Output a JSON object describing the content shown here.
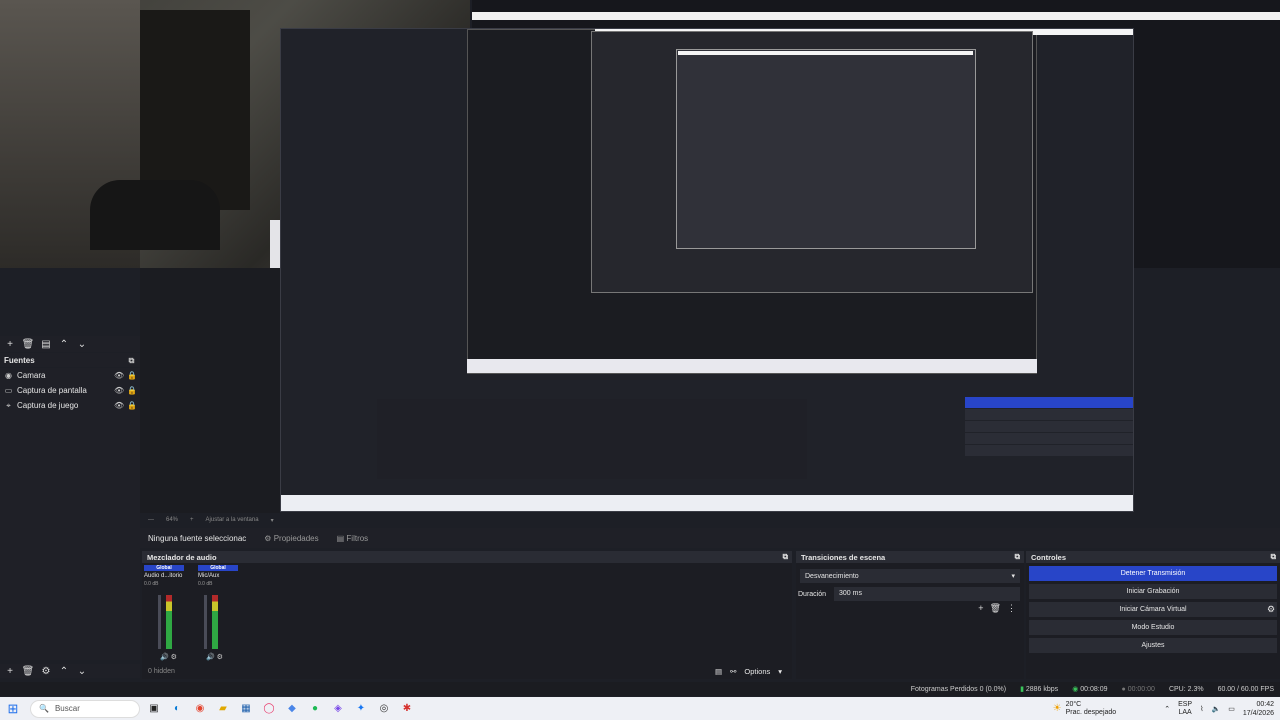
{
  "sources": {
    "title": "Fuentes",
    "items": [
      {
        "label": "Camara"
      },
      {
        "label": "Captura de pantalla"
      },
      {
        "label": "Captura de juego"
      }
    ]
  },
  "noselect": {
    "text": "Ninguna fuente seleccionac",
    "properties": "Propiedades",
    "filters": "Filtros"
  },
  "zoom": {
    "percent": "64%",
    "fit": "Ajustar a la ventana"
  },
  "mixer": {
    "title": "Mezclador de audio",
    "channels": [
      {
        "group": "Global",
        "device": "Audio d...itorio",
        "db": "0.0 dB"
      },
      {
        "group": "Global",
        "device": "Mic/Aux",
        "db": "0.0 dB"
      }
    ],
    "hidden": "0 hidden",
    "options": "Options"
  },
  "transitions": {
    "title": "Transiciones de escena",
    "selected": "Desvanecimiento",
    "duration_label": "Duración",
    "duration_value": "300 ms"
  },
  "controls": {
    "title": "Controles",
    "stop_stream": "Detener Transmisión",
    "start_record": "Iniciar Grabación",
    "virtual_cam": "Iniciar Cámara Virtual",
    "studio_mode": "Modo Estudio",
    "settings": "Ajustes"
  },
  "status": {
    "dropped": "Fotogramas Perdidos 0 (0.0%)",
    "kbps": "2886 kbps",
    "stream_time": "00:08:09",
    "rec_time": "00:00:00",
    "cpu": "CPU: 2.3%",
    "fps": "60.00 / 60.00 FPS"
  },
  "taskbar": {
    "search_placeholder": "Buscar",
    "weather_temp": "20°C",
    "weather_desc": "Prac. despejado",
    "lang": "ESP",
    "lang2": "LAA",
    "time": "00:42",
    "date": "17/4/2026"
  },
  "colors": {
    "accent": "#2845c8",
    "meter_green": "#2fa843"
  }
}
